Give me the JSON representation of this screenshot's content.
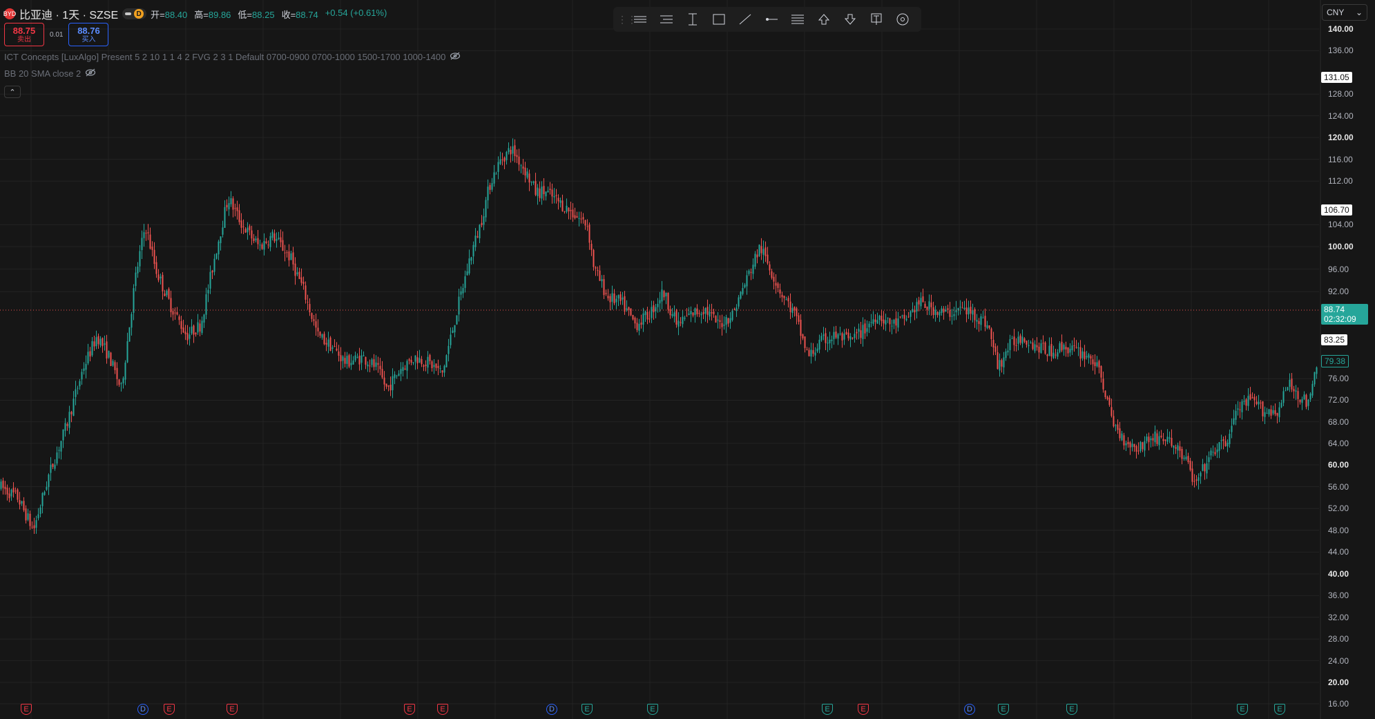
{
  "header": {
    "symbol_title": "比亚迪 · 1天 · SZSE",
    "logo_text": "BYD",
    "interval_badge": "D",
    "ohlc": [
      {
        "label": "开=",
        "value": "88.40"
      },
      {
        "label": "高=",
        "value": "89.86"
      },
      {
        "label": "低=",
        "value": "88.25"
      },
      {
        "label": "收=",
        "value": "88.74"
      }
    ],
    "change": "+0.54 (+0.61%)"
  },
  "trade": {
    "sell_price": "88.75",
    "sell_label": "卖出",
    "spread": "0.01",
    "buy_price": "88.76",
    "buy_label": "买入"
  },
  "indicators": [
    {
      "text": "ICT Concepts [LuxAlgo] Present 5 2 10 1 1 4 2 FVG 2 3 1 Default 0700-0900 0700-1000 1500-1700 1000-1400"
    },
    {
      "text": "BB 20 SMA close 2"
    }
  ],
  "toolbar": {
    "tools": [
      "horizontal-lines-icon",
      "level-lines-icon",
      "vertical-range-icon",
      "rectangle-icon",
      "trend-line-icon",
      "horizontal-ray-icon",
      "pitchfork-lines-icon",
      "arrow-up-icon",
      "arrow-down-icon",
      "text-note-icon",
      "target-icon"
    ]
  },
  "currency": {
    "value": "CNY"
  },
  "price_axis": {
    "ticks": [
      {
        "v": 140,
        "t": "140.00",
        "bold": true
      },
      {
        "v": 136,
        "t": "136.00",
        "bold": false
      },
      {
        "v": 128,
        "t": "128.00",
        "bold": false
      },
      {
        "v": 124,
        "t": "124.00",
        "bold": false
      },
      {
        "v": 120,
        "t": "120.00",
        "bold": true
      },
      {
        "v": 116,
        "t": "116.00",
        "bold": false
      },
      {
        "v": 112,
        "t": "112.00",
        "bold": false
      },
      {
        "v": 104,
        "t": "104.00",
        "bold": false
      },
      {
        "v": 100,
        "t": "100.00",
        "bold": true
      },
      {
        "v": 96,
        "t": "96.00",
        "bold": false
      },
      {
        "v": 92,
        "t": "92.00",
        "bold": false
      },
      {
        "v": 76,
        "t": "76.00",
        "bold": false
      },
      {
        "v": 72,
        "t": "72.00",
        "bold": false
      },
      {
        "v": 68,
        "t": "68.00",
        "bold": false
      },
      {
        "v": 64,
        "t": "64.00",
        "bold": false
      },
      {
        "v": 60,
        "t": "60.00",
        "bold": true
      },
      {
        "v": 56,
        "t": "56.00",
        "bold": false
      },
      {
        "v": 52,
        "t": "52.00",
        "bold": false
      },
      {
        "v": 48,
        "t": "48.00",
        "bold": false
      },
      {
        "v": 44,
        "t": "44.00",
        "bold": false
      },
      {
        "v": 40,
        "t": "40.00",
        "bold": true
      },
      {
        "v": 36,
        "t": "36.00",
        "bold": false
      },
      {
        "v": 32,
        "t": "32.00",
        "bold": false
      },
      {
        "v": 28,
        "t": "28.00",
        "bold": false
      },
      {
        "v": 24,
        "t": "24.00",
        "bold": false
      },
      {
        "v": 20,
        "t": "20.00",
        "bold": true
      },
      {
        "v": 16,
        "t": "16.00",
        "bold": false
      }
    ],
    "tags": [
      {
        "v": 131.05,
        "t": "131.05",
        "style": "white"
      },
      {
        "v": 106.7,
        "t": "106.70",
        "style": "white"
      },
      {
        "v": 83.25,
        "t": "83.25",
        "style": "white"
      },
      {
        "v": 79.38,
        "t": "79.38",
        "style": "outline"
      }
    ],
    "last_price": {
      "v": 88.74,
      "price": "88.74",
      "countdown": "02:32:09"
    }
  },
  "events": [
    {
      "kind": "earn-red",
      "label": "E"
    },
    {
      "kind": "div",
      "label": "D"
    },
    {
      "kind": "earn-red",
      "label": "E"
    },
    {
      "kind": "earn-red",
      "label": "E"
    },
    {
      "kind": "earn-red",
      "label": "E"
    },
    {
      "kind": "earn-red",
      "label": "E"
    },
    {
      "kind": "div",
      "label": "D"
    },
    {
      "kind": "earn-green",
      "label": "E"
    },
    {
      "kind": "earn-green",
      "label": "E"
    },
    {
      "kind": "earn-green",
      "label": "E"
    },
    {
      "kind": "earn-red",
      "label": "E"
    },
    {
      "kind": "div",
      "label": "D"
    },
    {
      "kind": "earn-green",
      "label": "E"
    },
    {
      "kind": "earn-green",
      "label": "E"
    },
    {
      "kind": "earn-green",
      "label": "E"
    },
    {
      "kind": "earn-green",
      "label": "E"
    }
  ],
  "colors": {
    "up": "#26a69a",
    "down": "#ef5350",
    "background": "#161616",
    "grid": "#232323",
    "last_line": "#ef5350"
  },
  "chart_data": {
    "type": "candlestick",
    "title": "比亚迪 · 1天 · SZSE",
    "ylim": [
      14,
      142
    ],
    "grid": true,
    "anchors": [
      [
        0,
        56
      ],
      [
        25,
        54
      ],
      [
        48,
        48
      ],
      [
        70,
        58
      ],
      [
        95,
        67
      ],
      [
        120,
        78
      ],
      [
        140,
        84
      ],
      [
        158,
        80
      ],
      [
        175,
        74
      ],
      [
        195,
        94
      ],
      [
        210,
        104
      ],
      [
        225,
        96
      ],
      [
        245,
        90
      ],
      [
        270,
        84
      ],
      [
        290,
        86
      ],
      [
        310,
        98
      ],
      [
        330,
        109
      ],
      [
        350,
        104
      ],
      [
        375,
        100
      ],
      [
        395,
        102
      ],
      [
        420,
        98
      ],
      [
        440,
        92
      ],
      [
        460,
        84
      ],
      [
        480,
        82
      ],
      [
        500,
        79
      ],
      [
        525,
        80
      ],
      [
        545,
        78
      ],
      [
        560,
        74
      ],
      [
        580,
        78
      ],
      [
        600,
        80
      ],
      [
        620,
        79
      ],
      [
        640,
        77
      ],
      [
        660,
        88
      ],
      [
        680,
        98
      ],
      [
        695,
        104
      ],
      [
        710,
        112
      ],
      [
        725,
        116
      ],
      [
        740,
        118
      ],
      [
        760,
        114
      ],
      [
        775,
        110
      ],
      [
        790,
        110
      ],
      [
        810,
        108
      ],
      [
        830,
        106
      ],
      [
        850,
        104
      ],
      [
        860,
        96
      ],
      [
        880,
        91
      ],
      [
        900,
        90
      ],
      [
        920,
        86
      ],
      [
        940,
        88
      ],
      [
        960,
        92
      ],
      [
        980,
        86
      ],
      [
        1000,
        88
      ],
      [
        1020,
        89
      ],
      [
        1040,
        86
      ],
      [
        1060,
        88
      ],
      [
        1080,
        94
      ],
      [
        1100,
        100
      ],
      [
        1115,
        96
      ],
      [
        1130,
        92
      ],
      [
        1150,
        88
      ],
      [
        1170,
        80
      ],
      [
        1190,
        83
      ],
      [
        1210,
        84
      ],
      [
        1230,
        83
      ],
      [
        1250,
        85
      ],
      [
        1270,
        88
      ],
      [
        1290,
        86
      ],
      [
        1310,
        87
      ],
      [
        1330,
        90
      ],
      [
        1350,
        89
      ],
      [
        1370,
        88
      ],
      [
        1390,
        89
      ],
      [
        1410,
        88
      ],
      [
        1430,
        86
      ],
      [
        1445,
        78
      ],
      [
        1460,
        82
      ],
      [
        1480,
        84
      ],
      [
        1500,
        82
      ],
      [
        1520,
        81
      ],
      [
        1540,
        82
      ],
      [
        1560,
        81
      ],
      [
        1580,
        80
      ],
      [
        1595,
        76
      ],
      [
        1610,
        68
      ],
      [
        1625,
        65
      ],
      [
        1645,
        63
      ],
      [
        1665,
        65
      ],
      [
        1685,
        65
      ],
      [
        1705,
        63
      ],
      [
        1720,
        60
      ],
      [
        1730,
        56
      ],
      [
        1745,
        60
      ],
      [
        1760,
        63
      ],
      [
        1775,
        64
      ],
      [
        1790,
        70
      ],
      [
        1810,
        72
      ],
      [
        1830,
        70
      ],
      [
        1850,
        70
      ],
      [
        1865,
        75
      ],
      [
        1880,
        73
      ],
      [
        1895,
        71
      ],
      [
        1905,
        78
      ],
      [
        1910,
        80
      ]
    ],
    "last_close": 88.74
  }
}
